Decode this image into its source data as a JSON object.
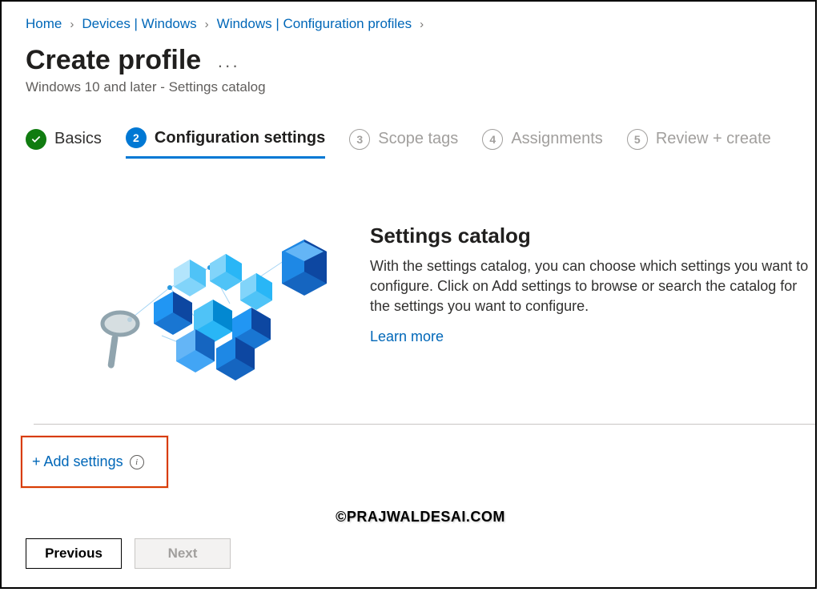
{
  "breadcrumb": {
    "items": [
      {
        "label": "Home"
      },
      {
        "label": "Devices | Windows"
      },
      {
        "label": "Windows | Configuration profiles"
      }
    ]
  },
  "header": {
    "title": "Create profile",
    "subtitle": "Windows 10 and later - Settings catalog",
    "more_tooltip": "More"
  },
  "stepper": {
    "steps": [
      {
        "num": "✓",
        "label": "Basics",
        "state": "done"
      },
      {
        "num": "2",
        "label": "Configuration settings",
        "state": "active"
      },
      {
        "num": "3",
        "label": "Scope tags",
        "state": "upcoming"
      },
      {
        "num": "4",
        "label": "Assignments",
        "state": "upcoming"
      },
      {
        "num": "5",
        "label": "Review + create",
        "state": "upcoming"
      }
    ]
  },
  "catalog": {
    "heading": "Settings catalog",
    "description": "With the settings catalog, you can choose which settings you want to configure. Click on Add settings to browse or search the catalog for the settings you want to configure.",
    "learn_more": "Learn more"
  },
  "actions": {
    "add_settings": "+ Add settings"
  },
  "watermark": "©PRAJWALDESAI.COM",
  "footer": {
    "previous": "Previous",
    "next": "Next"
  }
}
